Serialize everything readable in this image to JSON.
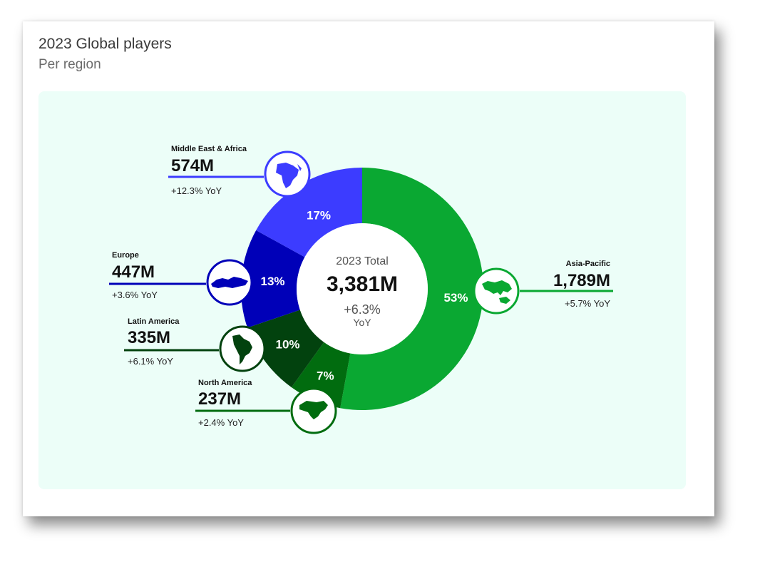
{
  "title": "2023 Global players",
  "subtitle": "Per region",
  "chart_data": {
    "type": "pie",
    "variant": "donut",
    "center": {
      "label": "2023 Total",
      "value": "3,381M",
      "change": "+6.3%",
      "change_unit": "YoY"
    },
    "slices": [
      {
        "name": "Asia-Pacific",
        "value_label": "1,789M",
        "value": 1789,
        "percent": 53,
        "percent_label": "53%",
        "yoy": "+5.7% YoY",
        "color": "#0aa832",
        "icon": "asia-pacific-map-icon"
      },
      {
        "name": "North America",
        "value_label": "237M",
        "value": 237,
        "percent": 7,
        "percent_label": "7%",
        "yoy": "+2.4% YoY",
        "color": "#016c0f",
        "icon": "north-america-map-icon"
      },
      {
        "name": "Latin America",
        "value_label": "335M",
        "value": 335,
        "percent": 10,
        "percent_label": "10%",
        "yoy": "+6.1% YoY",
        "color": "#02420e",
        "icon": "latin-america-map-icon"
      },
      {
        "name": "Europe",
        "value_label": "447M",
        "value": 447,
        "percent": 13,
        "percent_label": "13%",
        "yoy": "+3.6% YoY",
        "color": "#0000b8",
        "icon": "europe-map-icon"
      },
      {
        "name": "Middle East & Africa",
        "value_label": "574M",
        "value": 574,
        "percent": 17,
        "percent_label": "17%",
        "yoy": "+12.3% YoY",
        "color": "#3c3cff",
        "icon": "africa-map-icon"
      }
    ]
  }
}
